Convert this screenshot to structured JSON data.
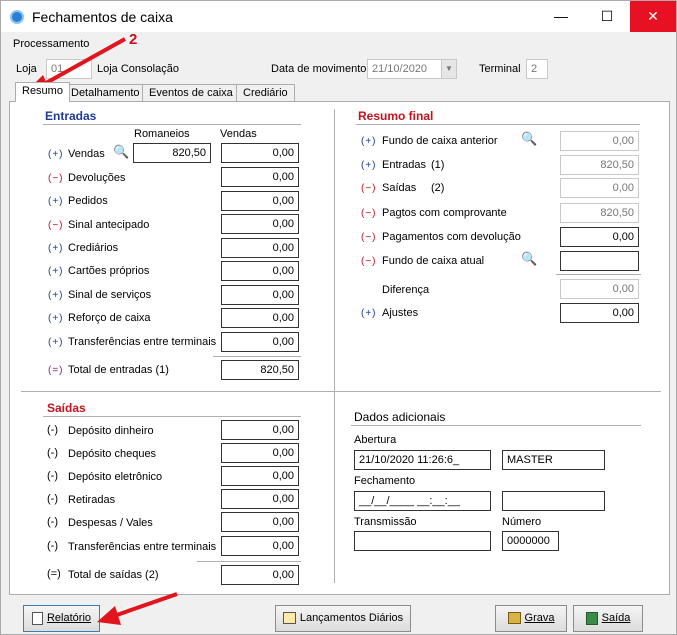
{
  "window": {
    "title": "Fechamentos de caixa",
    "min": "—",
    "max": "☐",
    "close": "✕"
  },
  "header": {
    "processamento": "Processamento",
    "loja_label": "Loja",
    "loja_value": "01",
    "loja_name": "Loja Consolação",
    "data_label": "Data de movimento",
    "data_value": "21/10/2020",
    "terminal_label": "Terminal",
    "terminal_value": "2",
    "annotation": "2"
  },
  "tabs": [
    "Resumo",
    "Detalhamento",
    "Eventos de caixa",
    "Crediário"
  ],
  "entradas": {
    "title": "Entradas",
    "col_romaneios": "Romaneios",
    "col_vendas": "Vendas",
    "rows": [
      {
        "sign": "(+)",
        "label": "Vendas",
        "romaneios": "820,50",
        "vendas": "0,00"
      },
      {
        "sign": "(−)",
        "label": "Devoluções",
        "vendas": "0,00"
      },
      {
        "sign": "(+)",
        "label": "Pedidos",
        "vendas": "0,00"
      },
      {
        "sign": "(−)",
        "label": "Sinal antecipado",
        "vendas": "0,00"
      },
      {
        "sign": "(+)",
        "label": "Crediários",
        "vendas": "0,00"
      },
      {
        "sign": "(+)",
        "label": "Cartões próprios",
        "vendas": "0,00"
      },
      {
        "sign": "(+)",
        "label": "Sinal de serviços",
        "vendas": "0,00"
      },
      {
        "sign": "(+)",
        "label": "Reforço de caixa",
        "vendas": "0,00"
      },
      {
        "sign": "(+)",
        "label": "Transferências entre terminais",
        "vendas": "0,00"
      }
    ],
    "total_sign": "(=)",
    "total_label": "Total de entradas (1)",
    "total_value": "820,50"
  },
  "resumo_final": {
    "title": "Resumo final",
    "rows": [
      {
        "sign": "(+)",
        "label": "Fundo de caixa anterior",
        "value": "0,00"
      },
      {
        "sign": "(+)",
        "label": "Entradas",
        "tag": "(1)",
        "value": "820,50"
      },
      {
        "sign": "(−)",
        "label": "Saídas",
        "tag": "(2)",
        "value": "0,00"
      },
      {
        "sign": "(−)",
        "label": "Pagtos com comprovante",
        "value": "820,50"
      },
      {
        "sign": "(−)",
        "label": "Pagamentos com devolução",
        "value": "0,00"
      },
      {
        "sign": "(−)",
        "label": "Fundo de caixa atual",
        "value": ""
      }
    ],
    "diferenca_label": "Diferença",
    "diferenca_value": "0,00",
    "ajustes_sign": "(+)",
    "ajustes_label": "Ajustes",
    "ajustes_value": "0,00"
  },
  "saidas": {
    "title": "Saídas",
    "rows": [
      {
        "sign": "(-)",
        "label": "Depósito dinheiro",
        "value": "0,00"
      },
      {
        "sign": "(-)",
        "label": "Depósito cheques",
        "value": "0,00"
      },
      {
        "sign": "(-)",
        "label": "Depósito eletrônico",
        "value": "0,00"
      },
      {
        "sign": "(-)",
        "label": "Retiradas",
        "value": "0,00"
      },
      {
        "sign": "(-)",
        "label": "Despesas / Vales",
        "value": "0,00"
      },
      {
        "sign": "(-)",
        "label": "Transferências entre terminais",
        "value": "0,00"
      }
    ],
    "total_sign": "(=)",
    "total_label": "Total de saídas (2)",
    "total_value": "0,00"
  },
  "dados": {
    "title": "Dados adicionais",
    "abertura_label": "Abertura",
    "abertura_value": "21/10/2020 11:26:6_",
    "abertura_user": "MASTER",
    "fechamento_label": "Fechamento",
    "fechamento_value": "__/__/____ __:__:__",
    "fechamento_user": "",
    "transmissao_label": "Transmissão",
    "transmissao_value": "",
    "numero_label": "Número",
    "numero_value": "0000000"
  },
  "buttons": {
    "relatorio": "Relatório",
    "lancamentos": "Lançamentos Diários",
    "grava": "Grava",
    "saida": "Saída"
  }
}
